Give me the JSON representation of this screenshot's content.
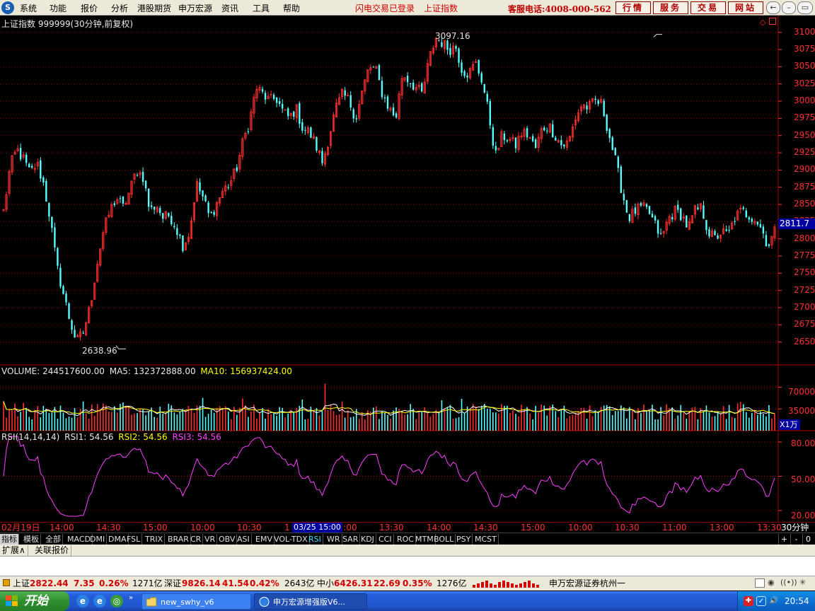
{
  "menubar": {
    "logo": "S",
    "items": [
      "系统",
      "功能",
      "报价",
      "分析",
      "港股期货",
      "申万宏源",
      "资讯",
      "工具",
      "帮助"
    ],
    "alerts": [
      "闪电交易已登录",
      "上证指数"
    ],
    "hotline": "客服电话:4008-000-562",
    "buttons": [
      "行情",
      "服务",
      "交易",
      "网站"
    ],
    "window_controls": [
      "←",
      "–",
      "▭",
      "✕"
    ]
  },
  "price_panel": {
    "title": "上证指数 999999(30分钟,前复权)",
    "high_label": "3097.16",
    "low_label": "2638.96",
    "last_price": "2811.7",
    "y_ticks": [
      "3100",
      "3075",
      "3050",
      "3025",
      "3000",
      "2975",
      "2950",
      "2925",
      "2900",
      "2875",
      "2850",
      "2825",
      "2800",
      "2775",
      "2750",
      "2725",
      "2700",
      "2675",
      "2650"
    ]
  },
  "volume_panel": {
    "label": "VOLUME: 244517600.00",
    "ma5": "MA5: 132372888.00",
    "ma10": "MA10: 156937424.00",
    "y_ticks": [
      "70000",
      "35000"
    ],
    "unit": "X1万"
  },
  "rsi_panel": {
    "label": "RSI(14,14,14)",
    "rsi1": "RSI1: 54.56",
    "rsi2": "RSI2: 54.56",
    "rsi3": "RSI3: 54.56",
    "y_ticks": [
      "80.00",
      "50.00",
      "20.00"
    ]
  },
  "time_axis": {
    "labels": [
      "02月19日",
      "14:00",
      "14:30",
      "15:00",
      "10:00",
      "10:30",
      "1",
      "11:00",
      "13:30",
      "14:00",
      "14:30",
      "15:00",
      "10:00",
      "10:30",
      "11:00",
      "13:00",
      "13:30"
    ],
    "cursor": "03/25 15:00",
    "period": "30分钟"
  },
  "indicator_tabs": [
    "指标",
    "模板",
    "全部",
    "MACD",
    "DMI",
    "DMA",
    "FSL",
    "TRIX",
    "BRAR",
    "CR",
    "VR",
    "OBV",
    "ASI",
    "EMV",
    "VOL-TDX",
    "RSI",
    "WR",
    "SAR",
    "KDJ",
    "CCI",
    "ROC",
    "MTM",
    "BOLL",
    "PSY",
    "MCST"
  ],
  "tab_controls": [
    "+",
    "-",
    "0"
  ],
  "ext_tabs": [
    "扩展∧",
    "关联报价"
  ],
  "statusbar": {
    "sh_name": "上证",
    "sh_price": "2822.44",
    "sh_chg": "7.35",
    "sh_pct": "0.26%",
    "sh_amt": "1271亿",
    "sz_name": "深证",
    "sz_price": "9826.14",
    "sz_chg": "41.54",
    "sz_pct": "0.42%",
    "sz_amt": "2643亿",
    "zx_name": "中小",
    "zx_price": "6426.31",
    "zx_chg": "22.69",
    "zx_pct": "0.35%",
    "zx_amt": "1276亿",
    "broker": "申万宏源证券杭州一"
  },
  "taskbar": {
    "start_label": "开始",
    "tasks": [
      "new_swhy_v6",
      "申万宏源增强版V6..."
    ],
    "clock": "20:54"
  },
  "colors": {
    "up": "#ff3030",
    "down": "#54ffff",
    "ma5": "#ffffff",
    "ma10": "#ffff00",
    "rsi": "#ff40ff",
    "grid": "#a00000"
  },
  "chart_data": {
    "type": "candlestick",
    "title": "上证指数 999999(30分钟,前复权)",
    "period": "30分钟",
    "price_range": [
      2625,
      3110
    ],
    "highest": 3097.16,
    "lowest": 2638.96,
    "last": 2811.7,
    "volume_range": [
      0,
      90000
    ],
    "volume_unit": "X1万",
    "rsi_range": [
      15,
      85
    ],
    "rsi_value": 54.56,
    "close_path": [
      2840,
      2905,
      2930,
      2915,
      2895,
      2910,
      2880,
      2830,
      2760,
      2720,
      2680,
      2650,
      2665,
      2700,
      2760,
      2810,
      2840,
      2860,
      2845,
      2870,
      2900,
      2890,
      2840,
      2850,
      2830,
      2835,
      2815,
      2790,
      2810,
      2880,
      2860,
      2830,
      2850,
      2870,
      2880,
      2900,
      2940,
      2970,
      3020,
      3010,
      3000,
      3005,
      2985,
      2975,
      2990,
      2960,
      2955,
      2935,
      2910,
      2950,
      2990,
      3010,
      3000,
      2975,
      3015,
      3050,
      3045,
      3010,
      2990,
      2975,
      3040,
      3030,
      3020,
      3010,
      3060,
      3092,
      3085,
      3075,
      3080,
      3045,
      3040,
      3055,
      3030,
      2980,
      2920,
      2950,
      2945,
      2935,
      2955,
      2950,
      2930,
      2960,
      2965,
      2950,
      2935,
      2940,
      2975,
      2995,
      2990,
      3000,
      2995,
      2955,
      2915,
      2870,
      2830,
      2840,
      2845,
      2840,
      2820,
      2800,
      2830,
      2840,
      2835,
      2815,
      2840,
      2845,
      2810,
      2800,
      2810,
      2805,
      2830,
      2840,
      2835,
      2830,
      2815,
      2790,
      2810
    ]
  }
}
